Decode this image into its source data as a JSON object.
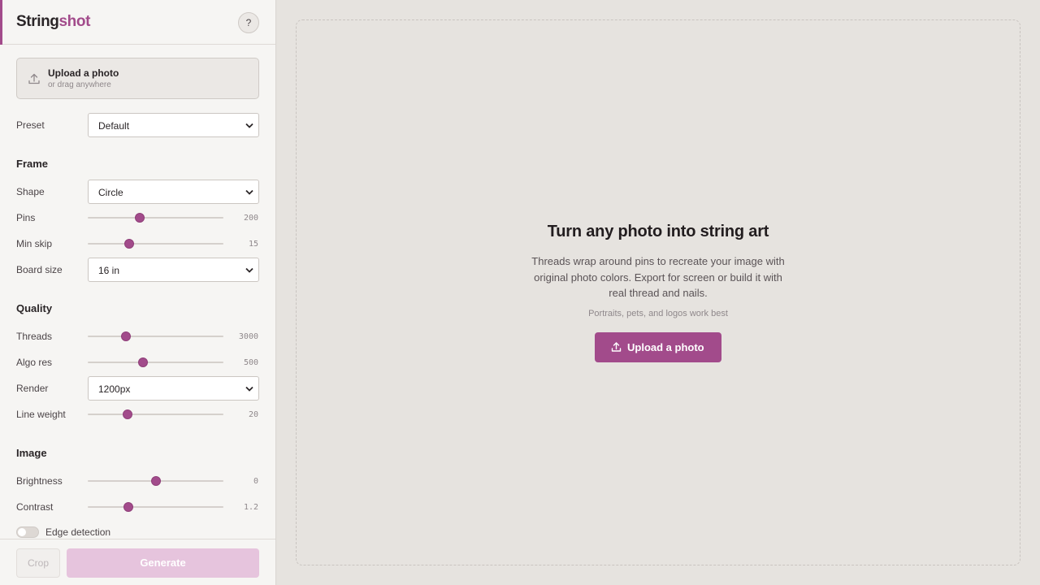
{
  "app": {
    "brand_part1": "String",
    "brand_part2": "shot",
    "help_label": "?",
    "accent_color": "#a24b8b"
  },
  "upload_card": {
    "title": "Upload a photo",
    "subtitle": "or drag anywhere",
    "icon": "upload-icon"
  },
  "preset": {
    "label": "Preset",
    "value": "Default"
  },
  "frame": {
    "title": "Frame",
    "shape": {
      "label": "Shape",
      "value": "Circle"
    },
    "pins": {
      "label": "Pins",
      "value": "200"
    },
    "min_skip": {
      "label": "Min skip",
      "value": "15"
    },
    "board_size": {
      "label": "Board size",
      "value": "16 in"
    }
  },
  "quality": {
    "title": "Quality",
    "threads": {
      "label": "Threads",
      "value": "3000"
    },
    "algo_res": {
      "label": "Algo res",
      "value": "500"
    },
    "render": {
      "label": "Render",
      "value": "1200px"
    },
    "line_weight": {
      "label": "Line weight",
      "value": "20"
    }
  },
  "image": {
    "title": "Image",
    "brightness": {
      "label": "Brightness",
      "value": "0"
    },
    "contrast": {
      "label": "Contrast",
      "value": "1.2"
    },
    "edge_detection": {
      "label": "Edge detection",
      "enabled": false
    }
  },
  "footer": {
    "crop_label": "Crop",
    "generate_label": "Generate"
  },
  "hero": {
    "title": "Turn any photo into string art",
    "description": "Threads wrap around pins to recreate your image with original photo colors. Export for screen or build it with real thread and nails.",
    "hint": "Portraits, pets, and logos work best",
    "button_label": "Upload a photo"
  }
}
